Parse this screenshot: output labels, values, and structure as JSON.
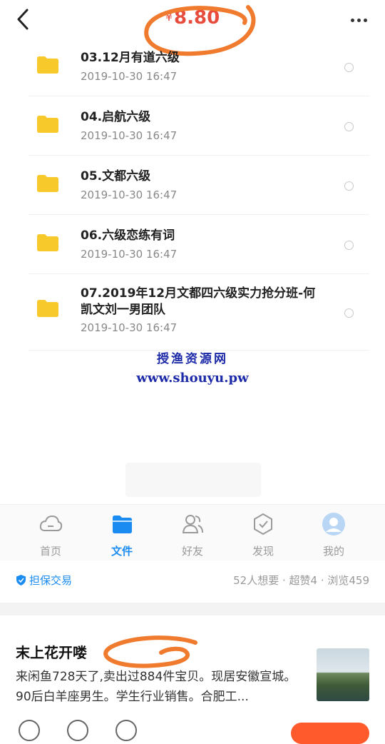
{
  "header": {
    "currency": "¥",
    "price": "8.80"
  },
  "files": [
    {
      "name": "03.12月有道六级",
      "date": "2019-10-30  16:47"
    },
    {
      "name": "04.启航六级",
      "date": "2019-10-30  16:47"
    },
    {
      "name": "05.文都六级",
      "date": "2019-10-30  16:47"
    },
    {
      "name": "06.六级恋练有词",
      "date": "2019-10-30  16:47"
    },
    {
      "name": "07.2019年12月文都四六级实力抢分班-何凯文刘一男团队",
      "date": "2019-10-30  16:47"
    }
  ],
  "watermark": {
    "line1": "授渔资源网",
    "line2": "www.shouyu.pw"
  },
  "tabs": [
    {
      "label": "首页",
      "icon": "cloud-home-icon"
    },
    {
      "label": "文件",
      "icon": "folder-icon"
    },
    {
      "label": "好友",
      "icon": "friends-icon"
    },
    {
      "label": "发现",
      "icon": "discover-icon"
    },
    {
      "label": "我的",
      "icon": "avatar-icon"
    }
  ],
  "stats": {
    "guarantee": "担保交易",
    "counts": "52人想要 · 超赞4 · 浏览459"
  },
  "seller": {
    "name": "末上花开喽",
    "description": "来闲鱼728天了,卖出过884件宝贝。现居安徽宣城。90后白羊座男生。学生行业销售。合肥工..."
  },
  "colors": {
    "price": "#e84c3d",
    "accent": "#1a8bf0",
    "folder": "#f8c92b",
    "annotation": "#f07a2e",
    "watermark": "#1d2aa8"
  }
}
